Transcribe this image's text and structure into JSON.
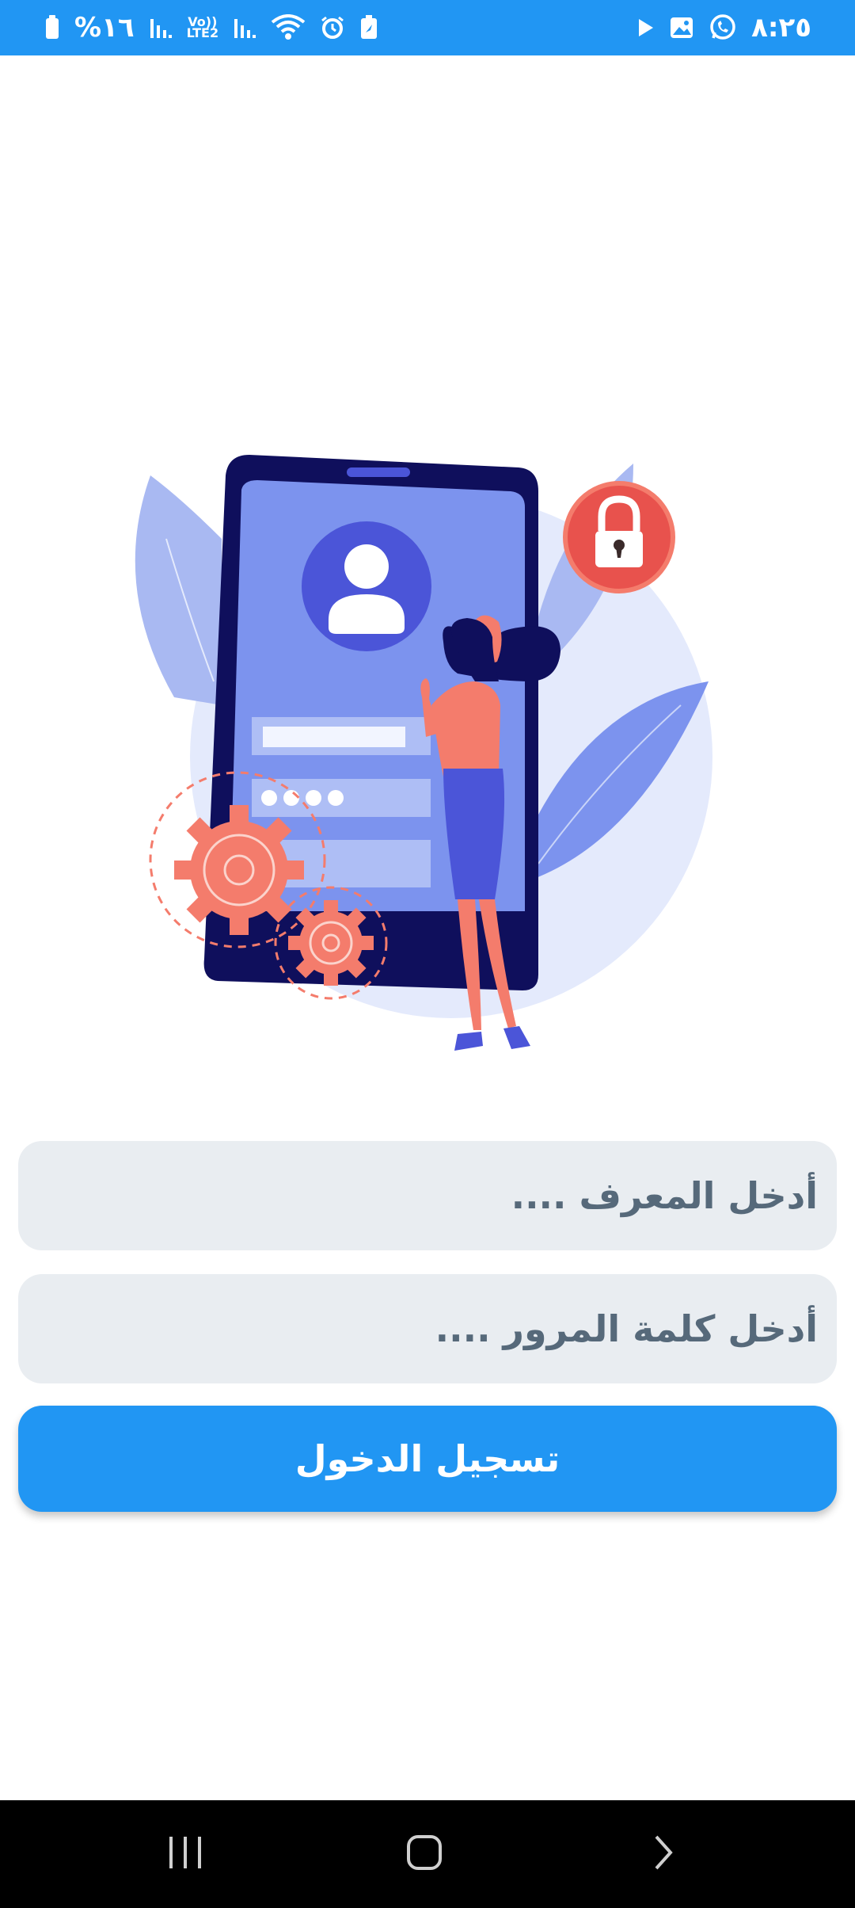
{
  "status_bar": {
    "battery_text": "%١٦",
    "volte_label": "Vo))",
    "lte_label": "LTE2",
    "time": "٨:٢٥",
    "icons": [
      "battery-icon",
      "signal-icon",
      "volte-icon",
      "signal-icon",
      "wifi-icon",
      "alarm-icon",
      "battery-saver-icon",
      "play-icon",
      "gallery-icon",
      "whatsapp-icon"
    ]
  },
  "illustration": {
    "name": "login-illustration",
    "colors": {
      "phone_dark": "#0f0f5c",
      "phone_screen": "#7c93ee",
      "accent_coral": "#f47c6c",
      "leaf_light": "#a9b9f2",
      "circle_bg": "#e4eafc",
      "lock_red": "#e8524d"
    }
  },
  "form": {
    "username_placeholder": "أدخل المعرف ....",
    "password_placeholder": "أدخل كلمة المرور ....",
    "login_label": "تسجيل الدخول",
    "field_bg": "#e9edf1",
    "button_color": "#2196f3"
  },
  "nav_bar": {
    "icons": [
      "recents-icon",
      "home-icon",
      "back-icon"
    ]
  }
}
